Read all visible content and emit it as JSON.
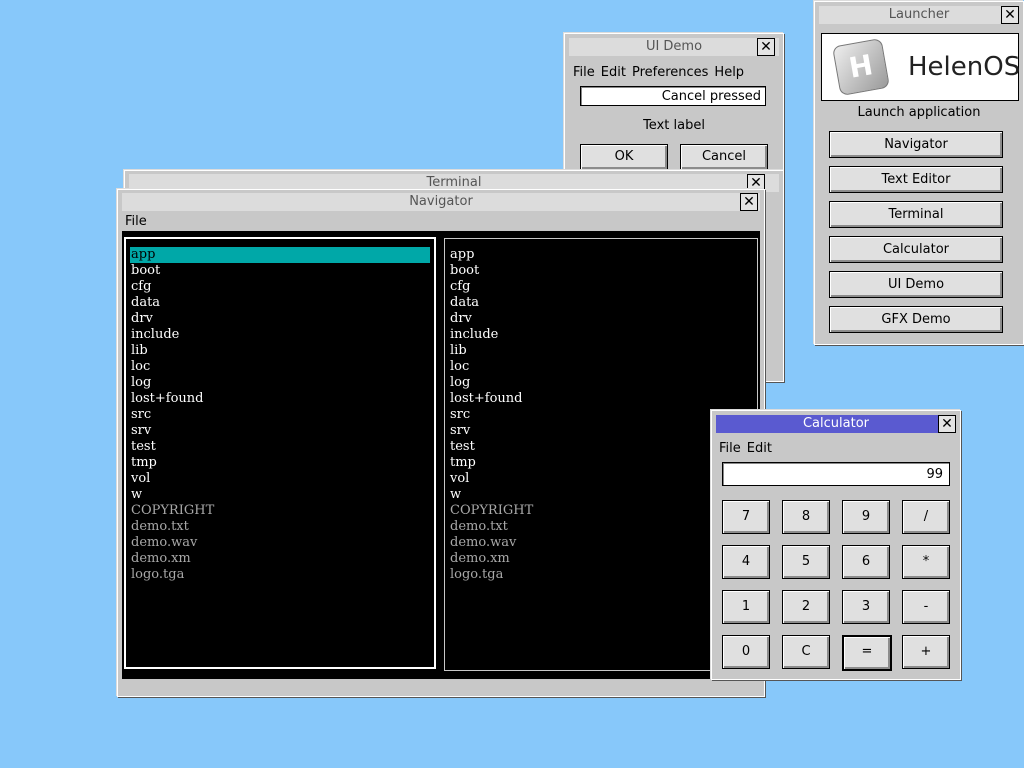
{
  "ui_demo": {
    "title": "UI Demo",
    "menu": [
      "File",
      "Edit",
      "Preferences",
      "Help"
    ],
    "entry_value": "Cancel pressed",
    "label": "Text label",
    "ok": "OK",
    "cancel": "Cancel"
  },
  "terminal": {
    "title": "Terminal"
  },
  "navigator": {
    "title": "Navigator",
    "menu": [
      "File"
    ],
    "left_panel": {
      "dirs": [
        "app",
        "boot",
        "cfg",
        "data",
        "drv",
        "include",
        "lib",
        "loc",
        "log",
        "lost+found",
        "src",
        "srv",
        "test",
        "tmp",
        "vol",
        "w"
      ],
      "files": [
        "COPYRIGHT",
        "demo.txt",
        "demo.wav",
        "demo.xm",
        "logo.tga"
      ],
      "selected": "app"
    },
    "right_panel": {
      "dirs": [
        "app",
        "boot",
        "cfg",
        "data",
        "drv",
        "include",
        "lib",
        "loc",
        "log",
        "lost+found",
        "src",
        "srv",
        "test",
        "tmp",
        "vol",
        "w"
      ],
      "files": [
        "COPYRIGHT",
        "demo.txt",
        "demo.wav",
        "demo.xm",
        "logo.tga"
      ]
    }
  },
  "launcher": {
    "title": "Launcher",
    "logo_text": "HelenOS",
    "logo_letter": "H",
    "heading": "Launch application",
    "apps": [
      "Navigator",
      "Text Editor",
      "Terminal",
      "Calculator",
      "UI Demo",
      "GFX Demo"
    ]
  },
  "calculator": {
    "title": "Calculator",
    "menu": [
      "File",
      "Edit"
    ],
    "display": "99",
    "keys": [
      [
        "7",
        "8",
        "9",
        "/"
      ],
      [
        "4",
        "5",
        "6",
        "*"
      ],
      [
        "1",
        "2",
        "3",
        "-"
      ],
      [
        "0",
        "C",
        "=",
        "+"
      ]
    ]
  },
  "colors": {
    "desktop": "#87c8fa",
    "active_title": "#5a5ad0",
    "selection": "#00a8a8"
  }
}
